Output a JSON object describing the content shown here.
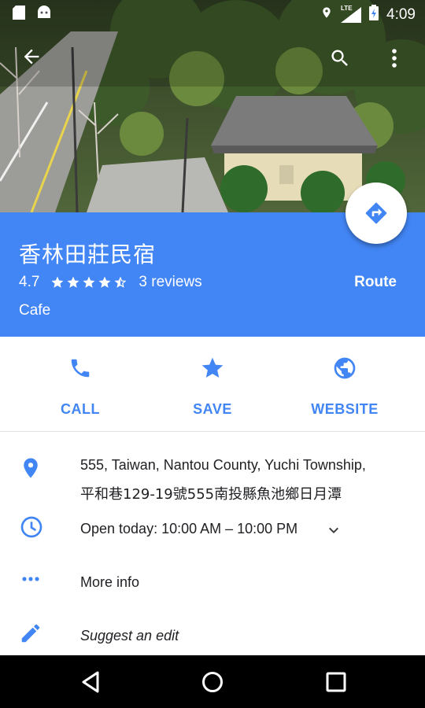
{
  "status_bar": {
    "time": "4:09",
    "network": "LTE"
  },
  "place": {
    "name": "香林田莊民宿",
    "rating": "4.7",
    "stars_value": 4.5,
    "reviews": "3 reviews",
    "category": "Cafe",
    "route_label": "Route"
  },
  "actions": {
    "call": "CALL",
    "save": "SAVE",
    "website": "WEBSITE"
  },
  "details": {
    "address_line1": "555, Taiwan, Nantou County, Yuchi Township,",
    "address_line2": "平和巷129-19號555南投縣魚池鄉日月潭",
    "hours": "Open today: 10:00 AM – 10:00 PM",
    "more_info": "More info",
    "suggest_edit": "Suggest an edit"
  },
  "colors": {
    "accent": "#4285f4",
    "header_bg": "#4285f4"
  }
}
